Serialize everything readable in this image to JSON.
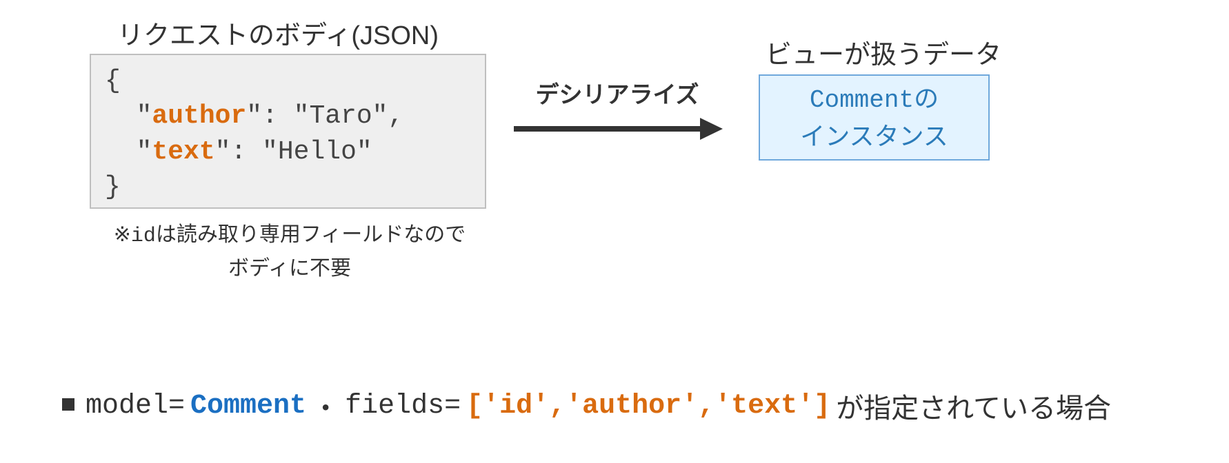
{
  "left": {
    "title": "リクエストのボディ(JSON)",
    "code": {
      "open": "{",
      "line1_pre": "  \"",
      "key1": "author",
      "line1_post": "\": \"Taro\",",
      "line2_pre": "  \"",
      "key2": "text",
      "line2_post": "\": \"Hello\"",
      "close": "}"
    },
    "note_line1_prefix": "※",
    "note_line1_id": "id",
    "note_line1_rest": "は読み取り専用フィールドなので",
    "note_line2": "ボディに不要"
  },
  "arrow": {
    "label": "デシリアライズ"
  },
  "right": {
    "title": "ビューが扱うデータ",
    "box_line1_comment": "Comment",
    "box_line1_no": "の",
    "box_line2": "インスタンス"
  },
  "bottom": {
    "model_eq": "model=",
    "model_val": "Comment",
    "dot": "・",
    "fields_eq": "fields=",
    "fields_val": "['id','author','text']",
    "trail": " が指定されている場合"
  }
}
